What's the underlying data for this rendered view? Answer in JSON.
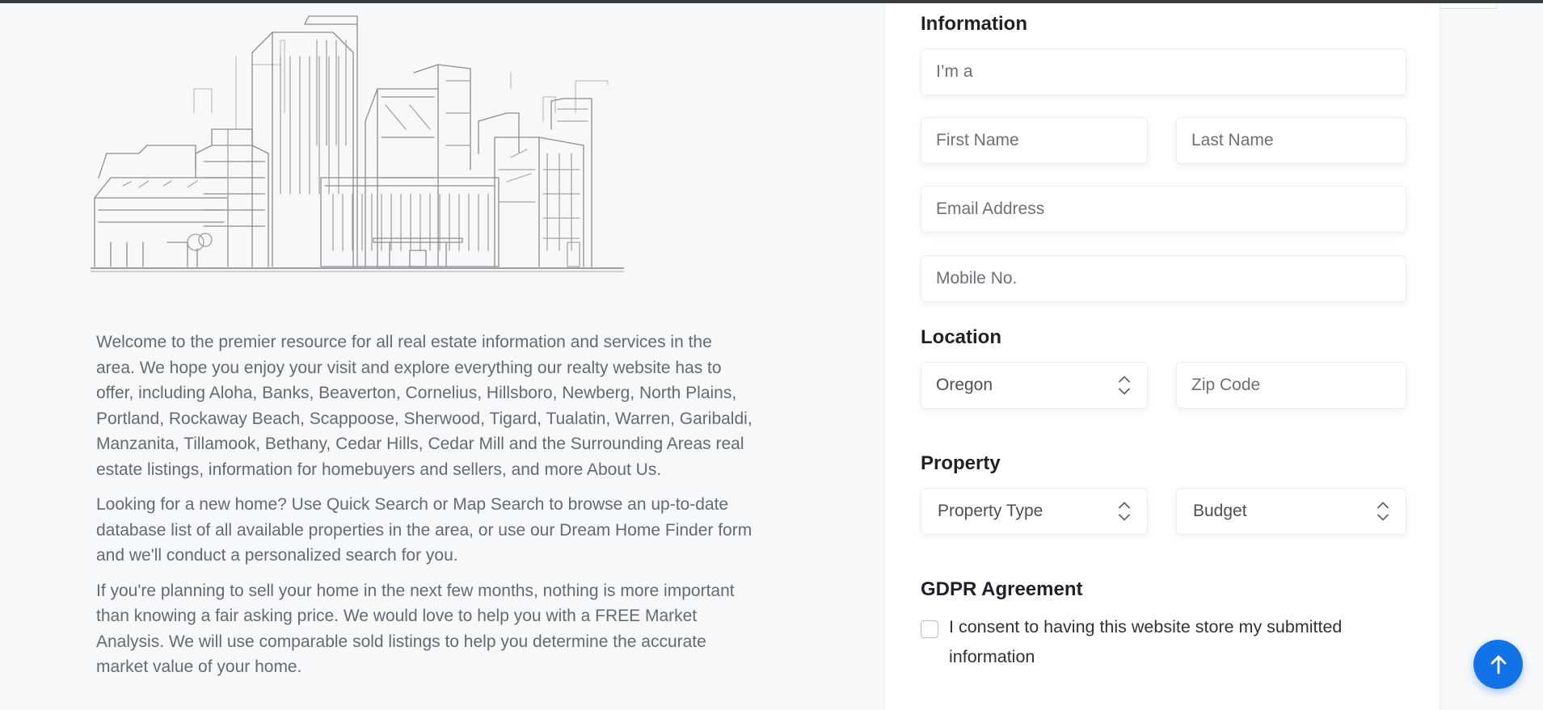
{
  "intro": {
    "paragraphs": [
      "Welcome to the premier resource for all real estate information and services in the area. We hope you enjoy your visit and explore everything our realty website has to offer, including Aloha, Banks, Beaverton, Cornelius, Hillsboro, Newberg, North Plains, Portland, Rockaway Beach, Scappoose, Sherwood, Tigard, Tualatin, Warren, Garibaldi, Manzanita, Tillamook, Bethany, Cedar Hills, Cedar Mill and the Surrounding Areas real estate listings, information for homebuyers and sellers, and more About Us.",
      "Looking for a new home? Use Quick Search or Map Search to browse an up-to-date database list of all available properties in the area, or use our Dream Home Finder form and we'll conduct a personalized search for you.",
      "If you're planning to sell your home in the next few months, nothing is more important than knowing a fair asking price. We would love to help you with a FREE Market Analysis. We will use comparable sold listings to help you determine the accurate market value of your home."
    ]
  },
  "form": {
    "information": {
      "title": "Information",
      "im_a_placeholder": "I’m a",
      "first_name_placeholder": "First Name",
      "last_name_placeholder": "Last Name",
      "email_placeholder": "Email Address",
      "mobile_placeholder": "Mobile No."
    },
    "location": {
      "title": "Location",
      "state_value": "Oregon",
      "zip_placeholder": "Zip Code"
    },
    "property": {
      "title": "Property",
      "type_value": "Property Type",
      "budget_value": "Budget"
    },
    "gdpr": {
      "title": "GDPR Agreement",
      "consent_text": "I consent to having this website store my submitted information",
      "checked": false
    }
  },
  "icons": {
    "select_chevrons": "chevron-up-down-icon",
    "scroll_top": "arrow-up-icon"
  },
  "colors": {
    "accent": "#1273e8",
    "background": "#f7f8f9",
    "heading": "#1f2329",
    "body_text": "#636a72"
  }
}
